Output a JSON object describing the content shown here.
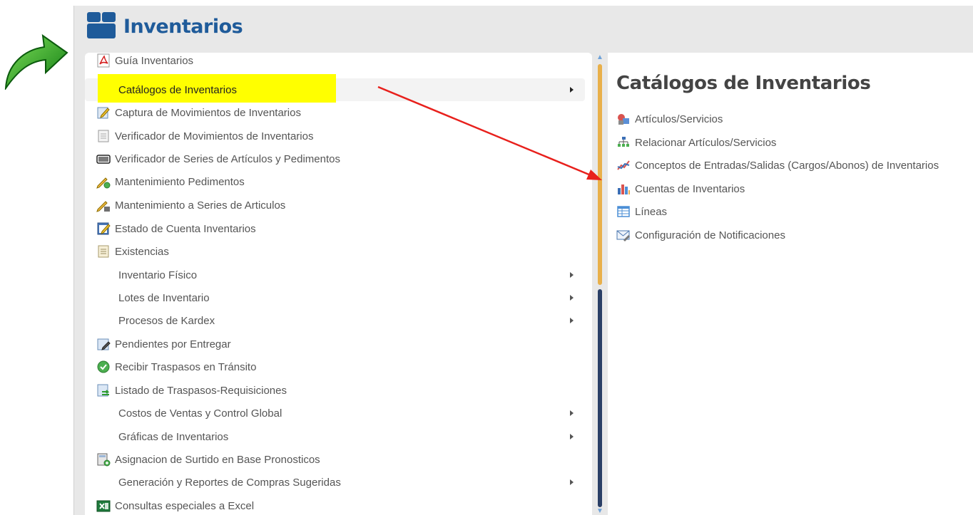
{
  "header": {
    "title": "Inventarios"
  },
  "menu": {
    "items": [
      {
        "label": "Guía Inventarios",
        "icon": "pdf-icon"
      },
      {
        "label": "Catálogos de Inventarios",
        "submenu": true,
        "active": true
      },
      {
        "label": "Captura de Movimientos de Inventarios",
        "icon": "edit-document-icon"
      },
      {
        "label": "Verificador de Movimientos de Inventarios",
        "icon": "document-icon"
      },
      {
        "label": "Verificador de Series de Artículos y Pedimentos",
        "icon": "barcode-icon"
      },
      {
        "label": "Mantenimiento Pedimentos",
        "icon": "pencil-gear-icon"
      },
      {
        "label": "Mantenimiento a Series de Articulos",
        "icon": "pencil-barcode-icon"
      },
      {
        "label": "Estado de Cuenta Inventarios",
        "icon": "notepad-pencil-icon"
      },
      {
        "label": "Existencias",
        "icon": "notes-icon"
      },
      {
        "label": "Inventario Físico",
        "submenu": true
      },
      {
        "label": "Lotes de Inventario",
        "submenu": true
      },
      {
        "label": "Procesos de Kardex",
        "submenu": true
      },
      {
        "label": "Pendientes por Entregar",
        "icon": "document-pen-icon"
      },
      {
        "label": "Recibir Traspasos en Tránsito",
        "icon": "check-circle-icon"
      },
      {
        "label": "Listado de Traspasos-Requisiciones",
        "icon": "document-transfer-icon"
      },
      {
        "label": "Costos de Ventas y Control Global",
        "submenu": true
      },
      {
        "label": "Gráficas de Inventarios",
        "submenu": true
      },
      {
        "label": "Asignacion de Surtido en Base Pronosticos",
        "icon": "calculator-add-icon"
      },
      {
        "label": "Generación y Reportes de Compras Sugeridas",
        "submenu": true
      },
      {
        "label": "Consultas especiales a Excel",
        "icon": "excel-icon"
      }
    ]
  },
  "catalog_panel": {
    "heading": "Catálogos de Inventarios",
    "items": [
      {
        "label": "Artículos/Servicios",
        "icon": "boxes-icon"
      },
      {
        "label": "Relacionar Artículos/Servicios",
        "icon": "hierarchy-icon"
      },
      {
        "label": "Conceptos de Entradas/Salidas (Cargos/Abonos) de Inventarios",
        "icon": "line-chart-icon"
      },
      {
        "label": "Cuentas de Inventarios",
        "icon": "bar-chart-icon"
      },
      {
        "label": "Líneas",
        "icon": "table-icon"
      },
      {
        "label": "Configuración de Notificaciones",
        "icon": "mail-settings-icon"
      }
    ]
  },
  "colors": {
    "title_blue": "#1f5b9a",
    "highlight_yellow": "#ffff00",
    "annotation_red": "#e8201c",
    "annotation_green": "#1f9c1f"
  }
}
